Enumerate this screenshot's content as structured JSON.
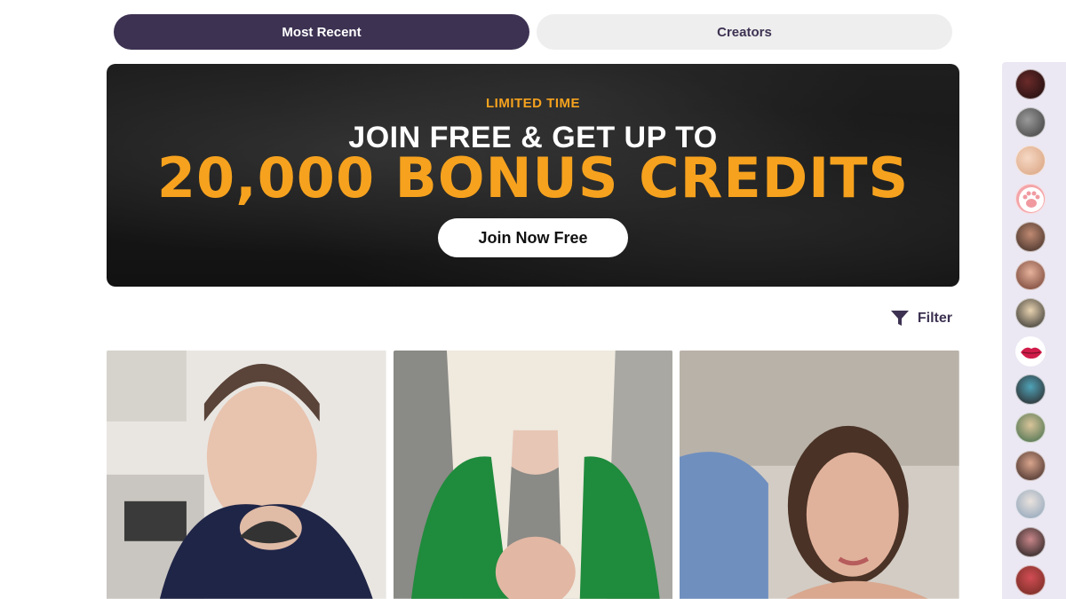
{
  "tabs": [
    {
      "label": "Most Recent",
      "active": true
    },
    {
      "label": "Creators",
      "active": false
    }
  ],
  "banner": {
    "eyebrow": "LIMITED TIME",
    "headline": "JOIN FREE & GET UP TO",
    "bigline": "20,000 BONUS CREDITS",
    "cta": "Join Now Free"
  },
  "filter": {
    "label": "Filter",
    "icon": "funnel-icon"
  },
  "colors": {
    "brand_dark": "#3d3252",
    "accent_orange": "#f6a21e",
    "sidebar_bg": "#ebe7f3"
  },
  "creator_cards": [
    {
      "name": "creator-card-1"
    },
    {
      "name": "creator-card-2"
    },
    {
      "name": "creator-card-3"
    }
  ],
  "sidebar": {
    "avatars": [
      "creator-avatar-1",
      "creator-avatar-2",
      "creator-avatar-3",
      "paw-avatar",
      "creator-avatar-5",
      "creator-avatar-6",
      "creator-avatar-7",
      "lips-avatar",
      "creator-avatar-9",
      "creator-avatar-10",
      "creator-avatar-11",
      "creator-avatar-12",
      "creator-avatar-13",
      "creator-avatar-14"
    ]
  }
}
